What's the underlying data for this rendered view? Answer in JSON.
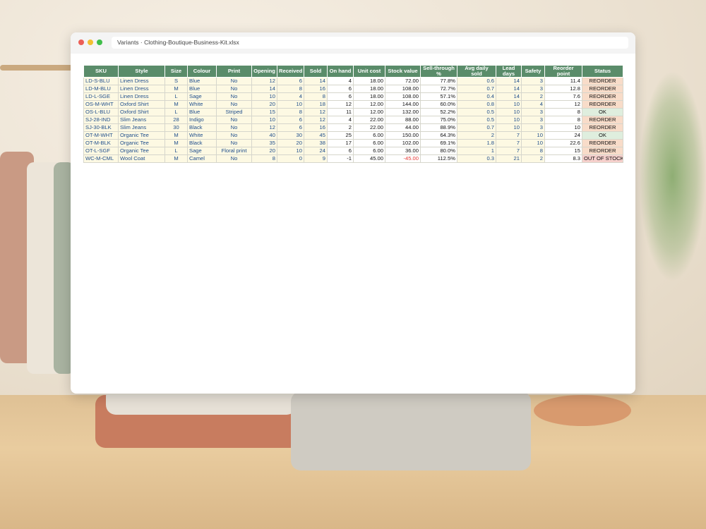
{
  "window": {
    "title": "Variants · Clothing-Boutique-Business-Kit.xlsx"
  },
  "colors": {
    "header_bg": "#5a8c6a",
    "input_bg": "#fdf9e3",
    "input_text": "#1f4e8c",
    "negative": "#e53935",
    "reorder_bg": "#f8dcc9",
    "ok_bg": "#dfeede",
    "out_bg": "#f6d0cc"
  },
  "table": {
    "headers": [
      "SKU",
      "Style",
      "Size",
      "Colour",
      "Print",
      "Opening",
      "Received",
      "Sold",
      "On hand",
      "Unit cost",
      "Stock value",
      "Sell-through %",
      "Avg daily sold",
      "Lead days",
      "Safety",
      "Reorder point",
      "Status"
    ],
    "rows": [
      [
        "LD-S-BLU",
        "Linen Dress",
        "S",
        "Blue",
        "No",
        "12",
        "6",
        "14",
        "4",
        "18.00",
        "72.00",
        "77.8%",
        "0.6",
        "14",
        "3",
        "11.4",
        "REORDER"
      ],
      [
        "LD-M-BLU",
        "Linen Dress",
        "M",
        "Blue",
        "No",
        "14",
        "8",
        "16",
        "6",
        "18.00",
        "108.00",
        "72.7%",
        "0.7",
        "14",
        "3",
        "12.8",
        "REORDER"
      ],
      [
        "LD-L-SGE",
        "Linen Dress",
        "L",
        "Sage",
        "No",
        "10",
        "4",
        "8",
        "6",
        "18.00",
        "108.00",
        "57.1%",
        "0.4",
        "14",
        "2",
        "7.6",
        "REORDER"
      ],
      [
        "OS-M-WHT",
        "Oxford Shirt",
        "M",
        "White",
        "No",
        "20",
        "10",
        "18",
        "12",
        "12.00",
        "144.00",
        "60.0%",
        "0.8",
        "10",
        "4",
        "12",
        "REORDER"
      ],
      [
        "OS-L-BLU",
        "Oxford Shirt",
        "L",
        "Blue",
        "Striped",
        "15",
        "8",
        "12",
        "11",
        "12.00",
        "132.00",
        "52.2%",
        "0.5",
        "10",
        "3",
        "8",
        "OK"
      ],
      [
        "SJ-28-IND",
        "Slim Jeans",
        "28",
        "Indigo",
        "No",
        "10",
        "6",
        "12",
        "4",
        "22.00",
        "88.00",
        "75.0%",
        "0.5",
        "10",
        "3",
        "8",
        "REORDER"
      ],
      [
        "SJ-30-BLK",
        "Slim Jeans",
        "30",
        "Black",
        "No",
        "12",
        "6",
        "16",
        "2",
        "22.00",
        "44.00",
        "88.9%",
        "0.7",
        "10",
        "3",
        "10",
        "REORDER"
      ],
      [
        "OT-M-WHT",
        "Organic Tee",
        "M",
        "White",
        "No",
        "40",
        "30",
        "45",
        "25",
        "6.00",
        "150.00",
        "64.3%",
        "2",
        "7",
        "10",
        "24",
        "OK"
      ],
      [
        "OT-M-BLK",
        "Organic Tee",
        "M",
        "Black",
        "No",
        "35",
        "20",
        "38",
        "17",
        "6.00",
        "102.00",
        "69.1%",
        "1.8",
        "7",
        "10",
        "22.6",
        "REORDER"
      ],
      [
        "OT-L-SGF",
        "Organic Tee",
        "L",
        "Sage",
        "Floral print",
        "20",
        "10",
        "24",
        "6",
        "6.00",
        "36.00",
        "80.0%",
        "1",
        "7",
        "8",
        "15",
        "REORDER"
      ],
      [
        "WC-M-CML",
        "Wool Coat",
        "M",
        "Camel",
        "No",
        "8",
        "0",
        "9",
        "-1",
        "45.00",
        "-45.00",
        "112.5%",
        "0.3",
        "21",
        "2",
        "8.3",
        "OUT OF STOCK"
      ]
    ]
  }
}
